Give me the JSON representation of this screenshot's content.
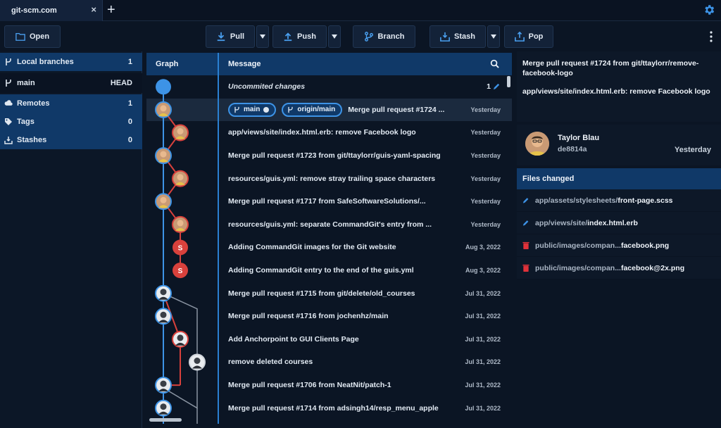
{
  "tab": {
    "title": "git-scm.com",
    "close": "×",
    "add": "+"
  },
  "toolbar": {
    "open": "Open",
    "pull": "Pull",
    "push": "Push",
    "branch": "Branch",
    "stash": "Stash",
    "pop": "Pop"
  },
  "sidebar": {
    "local_branches": {
      "label": "Local branches",
      "count": "1"
    },
    "main": {
      "label": "main",
      "tag": "HEAD"
    },
    "remotes": {
      "label": "Remotes",
      "count": "1"
    },
    "tags": {
      "label": "Tags",
      "count": "0"
    },
    "stashes": {
      "label": "Stashes",
      "count": "0"
    }
  },
  "columns": {
    "graph": "Graph",
    "message": "Message"
  },
  "uncommitted": {
    "label": "Uncommited changes",
    "count": "1"
  },
  "badges": {
    "local": "main",
    "remote": "origin/main"
  },
  "commits": [
    {
      "message": "Merge pull request #1724 ...",
      "date": "Yesterday",
      "avatar": "person"
    },
    {
      "message": "app/views/site/index.html.erb: remove Facebook logo",
      "date": "Yesterday",
      "avatar": "person-red"
    },
    {
      "message": "Merge pull request #1723 from git/ttaylorr/guis-yaml-spacing",
      "date": "Yesterday",
      "avatar": "person"
    },
    {
      "message": "resources/guis.yml: remove stray trailing space characters",
      "date": "Yesterday",
      "avatar": "person-red"
    },
    {
      "message": "Merge pull request #1717 from SafeSoftwareSolutions/...",
      "date": "Yesterday",
      "avatar": "person"
    },
    {
      "message": "resources/guis.yml: separate CommandGit's entry from ...",
      "date": "Yesterday",
      "avatar": "person-red"
    },
    {
      "message": "Adding CommandGit images for the Git website",
      "date": "Aug 3, 2022",
      "avatar": "S"
    },
    {
      "message": "Adding CommandGit entry to the end of the guis.yml",
      "date": "Aug 3, 2022",
      "avatar": "S"
    },
    {
      "message": "Merge pull request #1715 from git/delete/old_courses",
      "date": "Jul 31, 2022",
      "avatar": "person-dark"
    },
    {
      "message": "Merge pull request #1716 from jochenhz/main",
      "date": "Jul 31, 2022",
      "avatar": "person-dark"
    },
    {
      "message": "Add Anchorpoint to GUI Clients Page",
      "date": "Jul 31, 2022",
      "avatar": "person-dark-red"
    },
    {
      "message": "remove deleted courses",
      "date": "Jul 31, 2022",
      "avatar": "person-dark-grey"
    },
    {
      "message": "Merge pull request #1706 from NeatNit/patch-1",
      "date": "Jul 31, 2022",
      "avatar": "person-dark"
    },
    {
      "message": "Merge pull request #1714 from adsingh14/resp_menu_apple",
      "date": "Jul 31, 2022",
      "avatar": "person-dark"
    }
  ],
  "details": {
    "title": "Merge pull request #1724 from git/ttaylorr/remove-facebook-logo",
    "body": "app/views/site/index.html.erb: remove Facebook logo",
    "author": "Taylor Blau",
    "sha": "de8814a",
    "date": "Yesterday",
    "files_header": "Files changed",
    "files": [
      {
        "dir": "app/assets/stylesheets/",
        "name": "front-page.scss",
        "status": "modified"
      },
      {
        "dir": "app/views/site/",
        "name": "index.html.erb",
        "status": "modified"
      },
      {
        "dir": "public/images/compan... ",
        "name": "facebook.png",
        "status": "deleted"
      },
      {
        "dir": "public/images/compan... ",
        "name": "facebook@2x.png",
        "status": "deleted"
      }
    ]
  },
  "colors": {
    "accent": "#3d93e6",
    "header": "#103968",
    "branch_red": "#d9413c",
    "bg": "#0b1524"
  }
}
